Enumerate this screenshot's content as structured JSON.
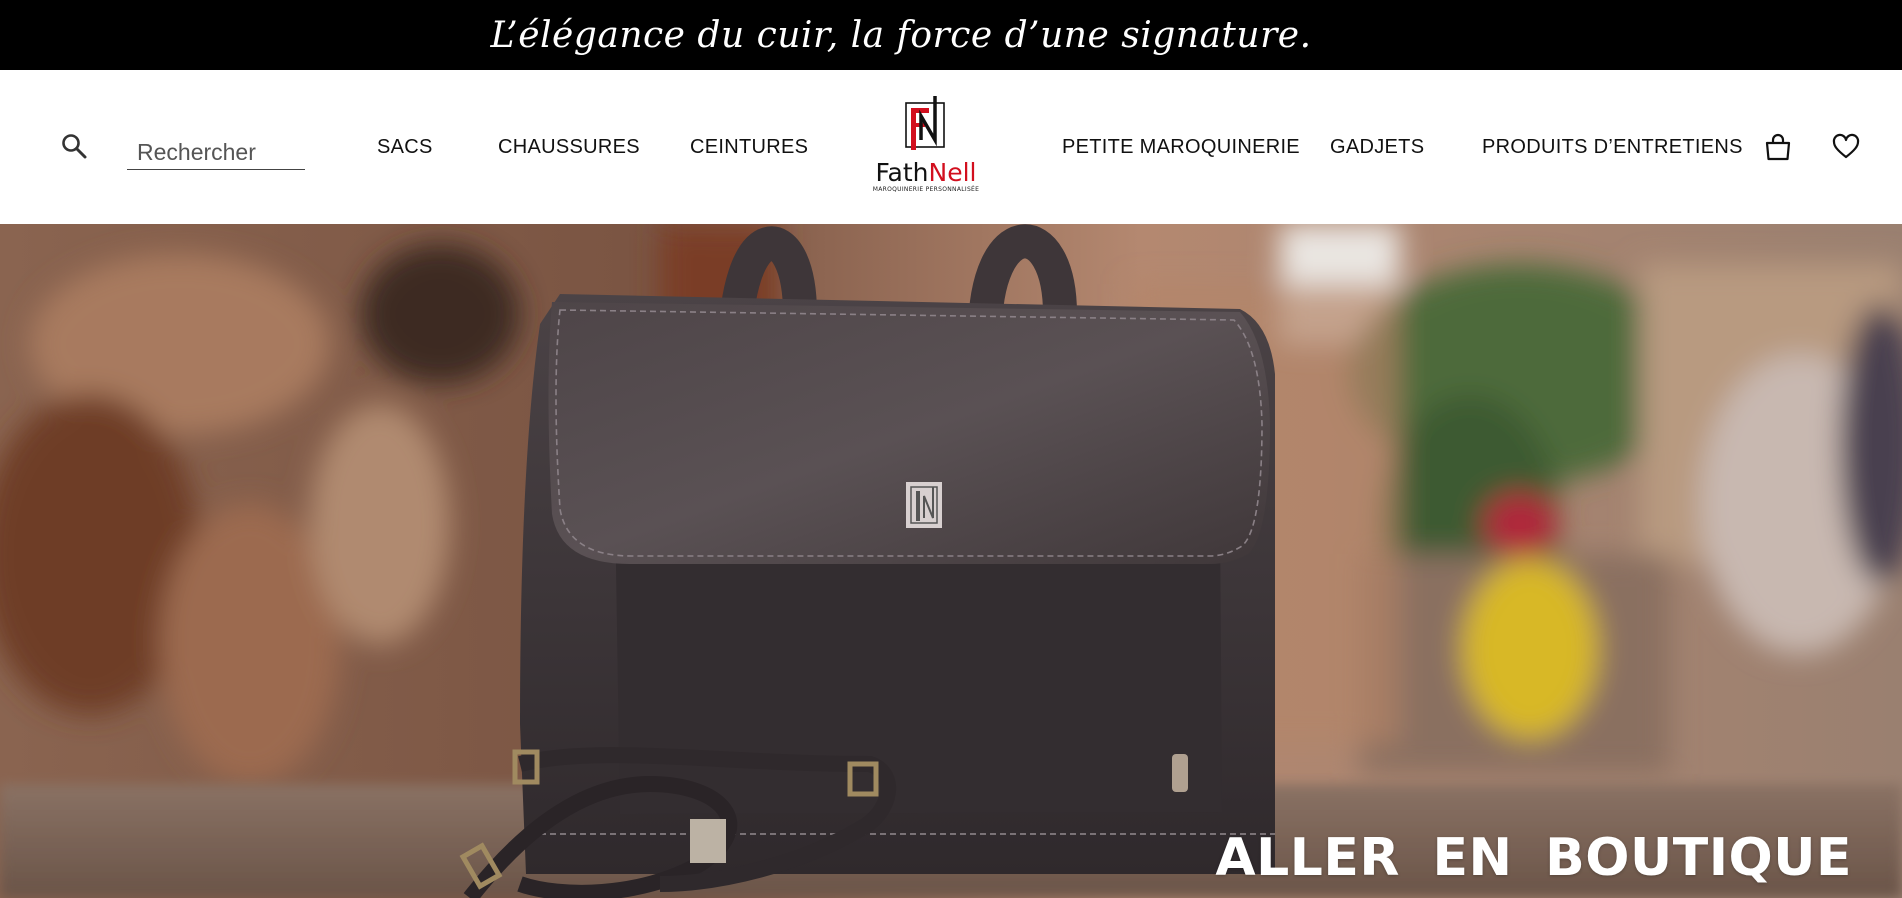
{
  "announcement": {
    "text": "L’élégance du cuir, la force d’une signature."
  },
  "search": {
    "placeholder": "Rechercher"
  },
  "nav_left": [
    {
      "label": "SACS"
    },
    {
      "label": "CHAUSSURES"
    },
    {
      "label": "CEINTURES"
    }
  ],
  "logo": {
    "monogram": "FN",
    "brand_black": "Fath",
    "brand_red": "Nell",
    "subtitle": "MAROQUINERIE PERSONNALISÉE"
  },
  "nav_right": [
    {
      "label": "PETITE MAROQUINERIE"
    },
    {
      "label": "GADJETS"
    },
    {
      "label": "PRODUITS D’ENTRETIENS"
    }
  ],
  "icons": {
    "search": "search-icon",
    "cart": "shopping-bag-icon",
    "wishlist": "heart-icon"
  },
  "hero": {
    "cta_label": "ALLER EN BOUTIQUE"
  },
  "colors": {
    "topbar_bg": "#000000",
    "brand_red": "#d20f1e",
    "text": "#111111",
    "cta": "#ffffff"
  }
}
